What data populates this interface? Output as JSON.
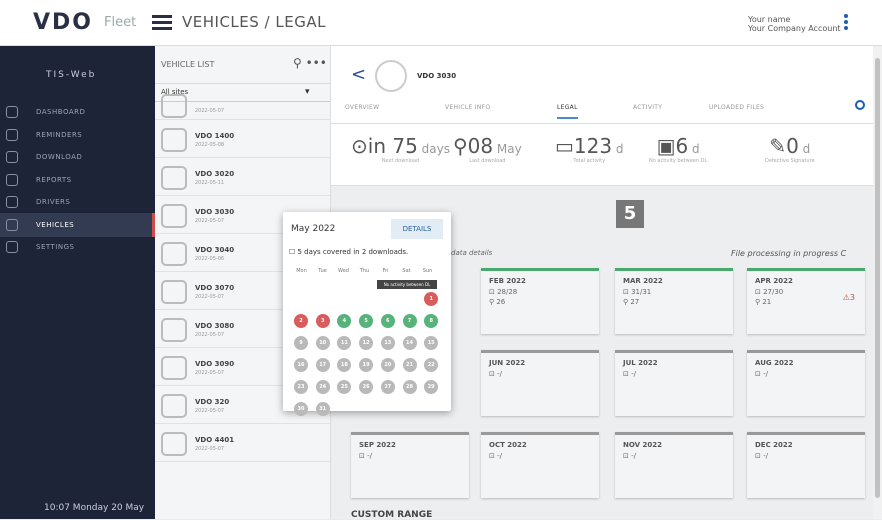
{
  "topbar": {
    "logo": "VDO",
    "logo_sub": "Fleet",
    "breadcrumb": "VEHICLES / LEGAL",
    "user_name": "Your name",
    "user_account": "Your Company Account"
  },
  "sidebar": {
    "brand": "TIS-Web",
    "items": [
      {
        "label": "DASHBOARD"
      },
      {
        "label": "REMINDERS"
      },
      {
        "label": "DOWNLOAD"
      },
      {
        "label": "REPORTS"
      },
      {
        "label": "DRIVERS"
      },
      {
        "label": "VEHICLES"
      },
      {
        "label": "SETTINGS"
      }
    ],
    "clock": "10:07 Monday 20 May"
  },
  "vehicle_list": {
    "title": "VEHICLE LIST",
    "search_icon": "⚲ •••",
    "sites": "All sites",
    "vehicles": [
      {
        "name": "",
        "date": "2022-05-07"
      },
      {
        "name": "VDO 1400",
        "date": "2022-05-08"
      },
      {
        "name": "VDO 3020",
        "date": "2022-05-11"
      },
      {
        "name": "VDO 3030",
        "date": "2022-05-07"
      },
      {
        "name": "VDO 3040",
        "date": "2022-05-06"
      },
      {
        "name": "VDO 3070",
        "date": "2022-05-07"
      },
      {
        "name": "VDO 3080",
        "date": "2022-05-07"
      },
      {
        "name": "VDO 3090",
        "date": "2022-05-07"
      },
      {
        "name": "VDO 320",
        "date": "2022-05-07"
      },
      {
        "name": "VDO 4401",
        "date": "2022-05-07"
      }
    ]
  },
  "header": {
    "vehicle": "VDO 3030",
    "tabs": [
      "OVERVIEW",
      "VEHICLE INFO",
      "LEGAL",
      "ACTIVITY",
      "UPLOADED FILES"
    ]
  },
  "stats": [
    {
      "pre": "⊙in ",
      "value": "75",
      "unit": " days",
      "caption": "Next download"
    },
    {
      "pre": "⚲",
      "value": "08",
      "unit": " May",
      "caption": "Last download"
    },
    {
      "pre": "▭",
      "value": "123",
      "unit": " d",
      "caption": "Total activity"
    },
    {
      "pre": "▣",
      "value": "6",
      "unit": " d",
      "caption": "No activity between DL"
    },
    {
      "pre": "✎",
      "value": "0",
      "unit": " d",
      "caption": "Defective Signature"
    }
  ],
  "badge": "5",
  "hint": "data details",
  "processing": "File processing in progress  C",
  "months": [
    {
      "m": "FEB 2022",
      "a": "⊡ 28/28",
      "b": "⚲ 26"
    },
    {
      "m": "MAR 2022",
      "a": "⊡ 31/31",
      "b": "⚲ 27"
    },
    {
      "m": "APR 2022",
      "a": "⊡ 27/30",
      "b": "⚲ 21",
      "r": "⚠3"
    },
    {
      "m": "JUN 2022",
      "a": "⊡ -/",
      "b": ""
    },
    {
      "m": "JUL 2022",
      "a": "⊡ -/",
      "b": ""
    },
    {
      "m": "AUG 2022",
      "a": "⊡ -/",
      "b": ""
    },
    {
      "m": "SEP 2022",
      "a": "⊡ -/",
      "b": ""
    },
    {
      "m": "OCT 2022",
      "a": "⊡ -/",
      "b": ""
    },
    {
      "m": "NOV 2022",
      "a": "⊡ -/",
      "b": ""
    },
    {
      "m": "DEC 2022",
      "a": "⊡ -/",
      "b": ""
    }
  ],
  "custom": "CUSTOM RANGE",
  "popup": {
    "title": "May 2022",
    "details": "DETAILS",
    "covered": "☐ 5 days covered in 2 downloads.",
    "weekdays": [
      "Mon",
      "Tue",
      "Wed",
      "Thu",
      "Fri",
      "Sat",
      "Sun"
    ],
    "tooltip": "No activity between DL",
    "days": [
      {
        "n": "1",
        "s": "r"
      },
      {
        "n": "2",
        "s": "r"
      },
      {
        "n": "3",
        "s": "r"
      },
      {
        "n": "4",
        "s": "g"
      },
      {
        "n": "5",
        "s": "g"
      },
      {
        "n": "6",
        "s": "g"
      },
      {
        "n": "7",
        "s": "g"
      },
      {
        "n": "8",
        "s": "g"
      },
      {
        "n": "9",
        "s": "s"
      },
      {
        "n": "10",
        "s": "s"
      },
      {
        "n": "11",
        "s": "s"
      },
      {
        "n": "12",
        "s": "s"
      },
      {
        "n": "13",
        "s": "s"
      },
      {
        "n": "14",
        "s": "s"
      },
      {
        "n": "15",
        "s": "s"
      },
      {
        "n": "16",
        "s": "s"
      },
      {
        "n": "17",
        "s": "s"
      },
      {
        "n": "18",
        "s": "s"
      },
      {
        "n": "19",
        "s": "s"
      },
      {
        "n": "20",
        "s": "s"
      },
      {
        "n": "21",
        "s": "s"
      },
      {
        "n": "22",
        "s": "s"
      },
      {
        "n": "23",
        "s": "s"
      },
      {
        "n": "24",
        "s": "s"
      },
      {
        "n": "25",
        "s": "s"
      },
      {
        "n": "26",
        "s": "s"
      },
      {
        "n": "27",
        "s": "s"
      },
      {
        "n": "28",
        "s": "s"
      },
      {
        "n": "29",
        "s": "s"
      },
      {
        "n": "30",
        "s": "s"
      },
      {
        "n": "31",
        "s": "s"
      }
    ]
  }
}
